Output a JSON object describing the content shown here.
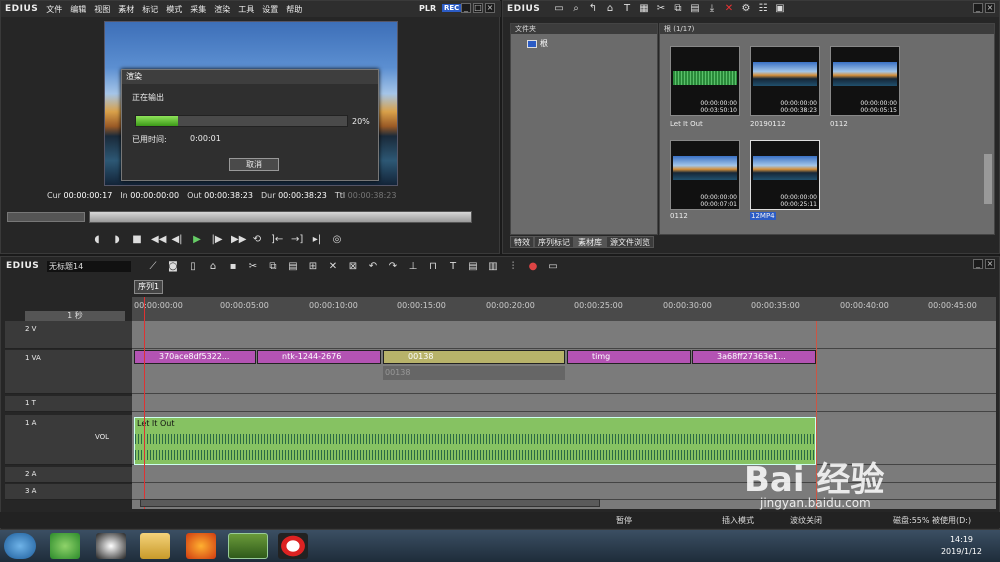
{
  "player": {
    "logo": "EDIUS",
    "menu": [
      "文件",
      "编辑",
      "视图",
      "素材",
      "标记",
      "模式",
      "采集",
      "渲染",
      "工具",
      "设置",
      "帮助"
    ],
    "plr": "PLR",
    "rec": "REC",
    "timecodes": [
      {
        "label": "Cur",
        "value": "00:00:00:17"
      },
      {
        "label": "In",
        "value": "00:00:00:00"
      },
      {
        "label": "Out",
        "value": "00:00:38:23"
      },
      {
        "label": "Dur",
        "value": "00:00:38:23"
      },
      {
        "label": "Ttl",
        "value": "00:00:38:23"
      }
    ]
  },
  "render_dialog": {
    "title": "渲染",
    "status": "正在输出",
    "progress_label": "20%",
    "progress_fraction": 0.2,
    "elapsed_label": "已用时间:",
    "elapsed_value": "0:00:01",
    "cancel": "取消"
  },
  "bin": {
    "logo": "EDIUS",
    "folder_header": "文件夹",
    "root": "根",
    "clip_header": "根 (1/17)",
    "clips": [
      {
        "name": "Let It Out",
        "tc1": "00:00:00:00",
        "tc2": "00:03:50:10",
        "kind": "audio"
      },
      {
        "name": "20190112",
        "tc1": "00:00:00:00",
        "tc2": "00:00:38:23",
        "kind": "video"
      },
      {
        "name": "0112",
        "tc1": "00:00:00:00",
        "tc2": "00:00:05:15",
        "kind": "video"
      },
      {
        "name": "0112",
        "tc1": "00:00:00:00",
        "tc2": "00:00:07:01",
        "kind": "video"
      },
      {
        "name": "12MP4",
        "tc1": "00:00:00:00",
        "tc2": "00:00:25:11",
        "kind": "video"
      }
    ],
    "tabs": [
      "特效",
      "序列标记",
      "素材库",
      "源文件浏览"
    ]
  },
  "timeline": {
    "logo": "EDIUS",
    "project": "无标题14",
    "sequence_tab": "序列1",
    "zoom": "1 秒",
    "ruler": [
      "00:00:00:00",
      "00:00:05:00",
      "00:00:10:00",
      "00:00:15:00",
      "00:00:20:00",
      "00:00:25:00",
      "00:00:30:00",
      "00:00:35:00",
      "00:00:40:00",
      "00:00:45:00"
    ],
    "tracks": [
      {
        "name": "2 V"
      },
      {
        "name": "1 VA"
      },
      {
        "name": "1 T"
      },
      {
        "name": "1 A"
      },
      {
        "name": "2 A"
      },
      {
        "name": "3 A"
      }
    ],
    "vol": "VOL",
    "video_clips": [
      "370ace8df5322...",
      "ntk-1244-2676",
      "00138",
      "timg",
      "3a68ff27363e1..."
    ],
    "ghost_clip": "00138",
    "audio_clip": "Let It Out"
  },
  "status": {
    "pause": "暂停",
    "insert": "插入模式",
    "ripple": "波纹关闭",
    "disk": "磁盘:55% 被使用(D:)"
  },
  "taskbar": {
    "time": "14:19",
    "date": "2019/1/12"
  },
  "watermark": {
    "text": "Bai 经验",
    "url": "jingyan.baidu.com"
  },
  "colors": {
    "accent": "#2c5cc5",
    "progress": "#5cc22a",
    "clip_purple": "#b353b3",
    "clip_olive": "#b8b36a",
    "audio": "#86c262"
  }
}
